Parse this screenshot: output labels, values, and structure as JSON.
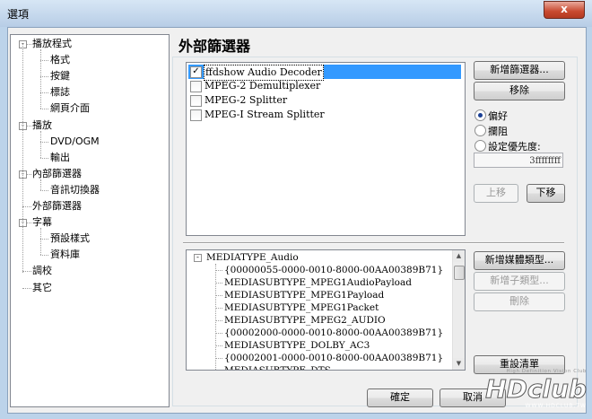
{
  "window": {
    "title": "選項",
    "close_symbol": "x"
  },
  "tree": [
    {
      "label": "播放程式",
      "level": 0,
      "expand": "-"
    },
    {
      "label": "格式",
      "level": 1
    },
    {
      "label": "按鍵",
      "level": 1
    },
    {
      "label": "標誌",
      "level": 1
    },
    {
      "label": "網頁介面",
      "level": 1
    },
    {
      "label": "播放",
      "level": 0,
      "expand": "-"
    },
    {
      "label": "DVD/OGM",
      "level": 1
    },
    {
      "label": "輸出",
      "level": 1
    },
    {
      "label": "內部篩選器",
      "level": 0,
      "expand": "-"
    },
    {
      "label": "音訊切換器",
      "level": 1
    },
    {
      "label": "外部篩選器",
      "level": 0
    },
    {
      "label": "字幕",
      "level": 0,
      "expand": "-"
    },
    {
      "label": "預設樣式",
      "level": 1
    },
    {
      "label": "資料庫",
      "level": 1
    },
    {
      "label": "調校",
      "level": 0
    },
    {
      "label": "其它",
      "level": 0
    }
  ],
  "page": {
    "title": "外部篩選器"
  },
  "filters": [
    {
      "label": "ffdshow Audio Decoder",
      "checked": true,
      "selected": true
    },
    {
      "label": "MPEG-2 Demultiplexer",
      "checked": false
    },
    {
      "label": "MPEG-2 Splitter",
      "checked": false
    },
    {
      "label": "MPEG-I Stream Splitter",
      "checked": false
    }
  ],
  "buttons": {
    "add_filter": "新增篩選器...",
    "remove": "移除",
    "move_up": "上移",
    "move_down": "下移",
    "add_media_type": "新增媒體類型...",
    "add_subtype": "新增子類型...",
    "delete": "刪除",
    "reset_list": "重設清單",
    "ok": "確定",
    "cancel": "取消"
  },
  "radios": [
    {
      "label": "偏好",
      "checked": true
    },
    {
      "label": "攔阻",
      "checked": false
    },
    {
      "label": "設定優先度:",
      "checked": false
    }
  ],
  "priority_value": "3ffffffff",
  "media_types": {
    "expand": "-",
    "root": "MEDIATYPE_Audio",
    "children": [
      "{00000055-0000-0010-8000-00AA00389B71}",
      "MEDIASUBTYPE_MPEG1AudioPayload",
      "MEDIASUBTYPE_MPEG1Payload",
      "MEDIASUBTYPE_MPEG1Packet",
      "MEDIASUBTYPE_MPEG2_AUDIO",
      "{00002000-0000-0010-8000-00AA00389B71}",
      "MEDIASUBTYPE_DOLBY_AC3",
      "{00002001-0000-0010-8000-00AA00389B71}",
      "MEDIASUBTYPE_DTS"
    ]
  },
  "scroll_arrows": {
    "up": "▲",
    "down": "▼"
  },
  "watermark": {
    "tagline": "High Definition Vision Club",
    "logo_text": "HDclub",
    "url": "WWW.HDCLUB.TW"
  },
  "colors": {
    "title_bar": "#b7cde6",
    "close_button": "#c8492f",
    "dialog_bg": "#f0f0f0"
  }
}
